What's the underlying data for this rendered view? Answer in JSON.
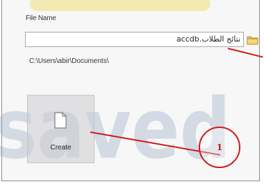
{
  "dialog": {
    "file_name_label": "File Name",
    "file_name_value": "نتائج الطلاب.accdb",
    "path": "C:\\Users\\abir\\Documents\\",
    "create_label": "Create"
  },
  "icons": {
    "browse": "folder-icon",
    "new_file": "document-icon"
  },
  "annotation": {
    "number": "1",
    "color": "#d01818"
  },
  "watermark": {
    "text": "saved"
  }
}
